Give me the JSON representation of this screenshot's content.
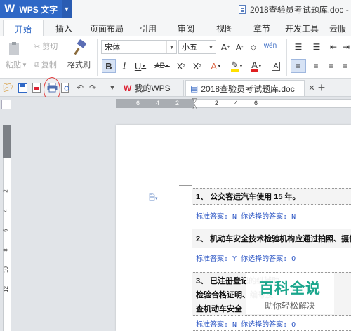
{
  "app": {
    "name": "WPS 文字",
    "logo": "W"
  },
  "window": {
    "doc_title": "2018查验员考试题库.doc - ..."
  },
  "ribbon_tabs": [
    "开始",
    "插入",
    "页面布局",
    "引用",
    "审阅",
    "视图",
    "章节",
    "开发工具",
    "云服"
  ],
  "ribbon": {
    "cut": "剪切",
    "paste": "粘贴",
    "copy": "复制",
    "format_painter": "格式刷",
    "font_name": "宋体",
    "font_size": "小五"
  },
  "doc_tabs": [
    "我的WPS",
    "2018查验员考试题库.doc"
  ],
  "ruler_numbers": [
    "6",
    "4",
    "2",
    "2",
    "4",
    "6"
  ],
  "vruler_numbers": [
    "2",
    "4",
    "6",
    "8",
    "10",
    "12"
  ],
  "questions": [
    {
      "text": "1、 公交客运汽车使用 15 年。",
      "answer": "标准答案: N  你选择的答案: N"
    },
    {
      "text": "2、 机动车安全技术检验机构应通过拍照、摄像",
      "answer": "标准答案: Y  你选择的答案: O"
    },
    {
      "text_lines": [
        "3、 已注册登记的纵辅助",
        "检验合格证明、编号及",
        "查机动车安全"
      ],
      "answer": "标准答案: N  你选择的答案: O"
    }
  ],
  "watermark": {
    "title": "百科全说",
    "subtitle": "助你轻松解决"
  },
  "colors": {
    "accent": "#2f68c6",
    "answer_text": "#2b55c4",
    "highlight_circle": "#e23b3b",
    "watermark": "#1aa68c"
  },
  "icons": [
    "save-icon",
    "print-icon",
    "undo-icon",
    "redo-icon",
    "new-tab-icon"
  ]
}
